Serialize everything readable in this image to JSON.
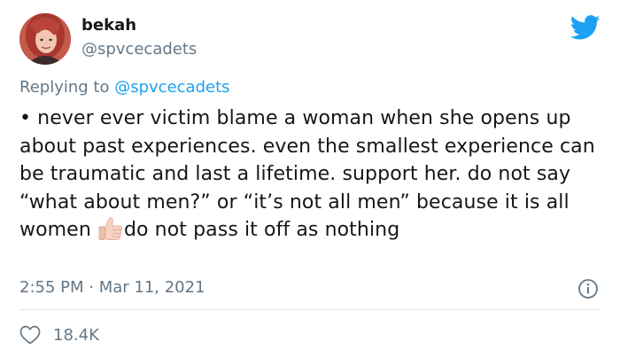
{
  "author": {
    "name": "bekah",
    "handle": "@spvcecadets"
  },
  "reply": {
    "prefix": "Replying to",
    "to": "@spvcecadets"
  },
  "tweet": {
    "text_before_emoji": "• never ever victim blame a woman when she opens up about past experiences. even the smallest experience can be traumatic and last a lifetime. support her. do not say “what about men?” or “it’s not all men” because it is all women ",
    "emoji": "thumbs-up",
    "text_after_emoji": "do not pass it off as nothing",
    "timestamp": "2:55 PM · Mar 11, 2021",
    "likes": "18.4K"
  },
  "icons": {
    "brand": "twitter-bird-icon",
    "info": "info-icon",
    "like": "heart-icon"
  },
  "colors": {
    "brand_blue": "#1da1f2",
    "text": "#14171a",
    "secondary": "#657786",
    "divider": "#e1e8ed"
  }
}
